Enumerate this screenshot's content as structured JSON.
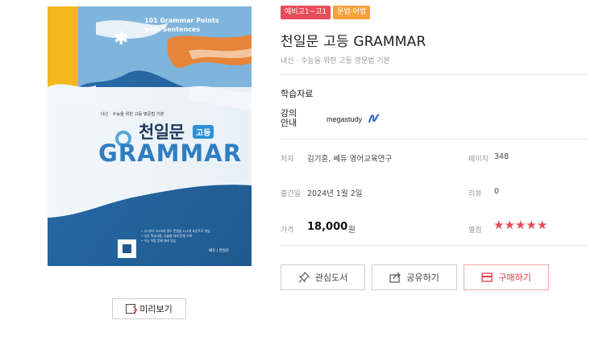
{
  "cover": {
    "top_text_line1": "101 Grammar Points",
    "top_text_line2": "with Sentences",
    "subtitle": "내신 · 수능을 위한 고등 영문법 기본",
    "title_ko": "천일문",
    "badge": "고등",
    "title_en": "GRAMMAR",
    "bullets": [
      "• 고1부터 고3까지 필수 문법을 101개 포인트로 개념",
      "• 내신 학교시험, 서술형 대비 문제 수록",
      "• 수능 어법 문제 대비 연습"
    ],
    "publisher": "쎄듀 | 천일문"
  },
  "preview_button": {
    "label": "미리보기"
  },
  "tags": [
    {
      "label": "예비고1~고1",
      "color": "#e94b5b"
    },
    {
      "label": "문법·어법",
      "color": "#f6a13a"
    }
  ],
  "title": "천일문 고등 GRAMMAR",
  "subtitle": "내신 · 수능을 위한 고등 영문법 기본",
  "section_heading": "학습자료",
  "lecture": {
    "label": "강의안내",
    "provider": "megastudy"
  },
  "details": {
    "author_label": "저자",
    "author_value": "김기훈, 쎄듀 영어교육연구",
    "pages_label": "페이지",
    "pages_value": "348",
    "date_label": "출간일",
    "date_value": "2024년 1월 2일",
    "review_label": "리뷰",
    "review_value": "0",
    "price_label": "가격",
    "price_value": "18,000",
    "price_unit": "원",
    "rating_label": "별점",
    "rating_value": 5,
    "rating_max": 5
  },
  "actions": {
    "wishlist": "관심도서",
    "share": "공유하기",
    "buy": "구매하기"
  },
  "colors": {
    "accent": "#e94b5b",
    "tag_orange": "#f6a13a",
    "cover_blue": "#1f5a8e"
  },
  "icons": {
    "preview": "preview-doc-icon",
    "wishlist": "pin-icon",
    "share": "share-icon",
    "buy": "card-icon"
  }
}
